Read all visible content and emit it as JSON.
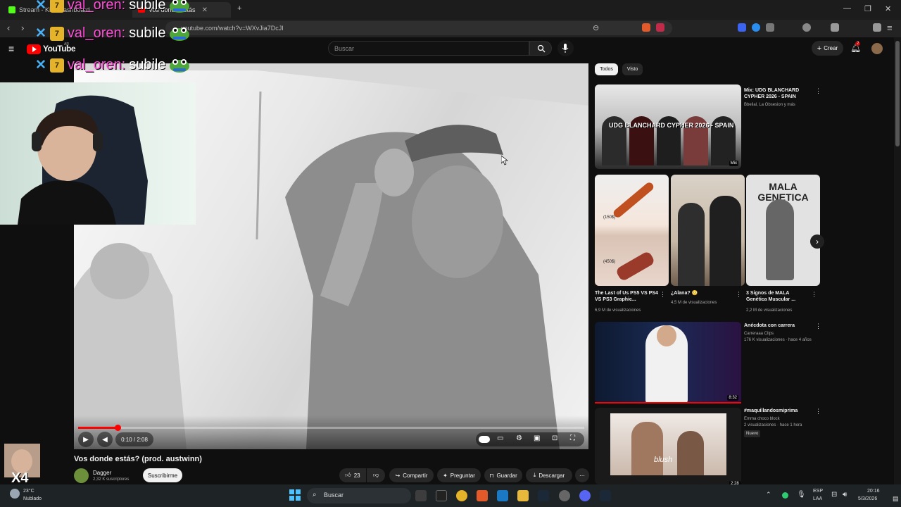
{
  "browser": {
    "tabs": [
      {
        "label": "Stream - Kick Dashboard"
      },
      {
        "label": "Vos donde estás"
      }
    ],
    "url": "youtube.com/watch?v=WXvJia7DcJI"
  },
  "youtube": {
    "logo_text": "YouTube",
    "logo_region": "AR",
    "search_placeholder": "Buscar",
    "create_label": "Crear",
    "notif_count": "2"
  },
  "player": {
    "time": "0:10 / 2:08",
    "progress_fraction": 0.078
  },
  "video": {
    "title": "Vos donde estás? (prod. austwinn)",
    "channel": "Dagger",
    "subscribers": "2,32 K suscriptores",
    "subscribe_label": "Suscribirme",
    "likes": "23",
    "share": "Compartir",
    "ask": "Preguntar",
    "save": "Guardar",
    "download": "Descargar"
  },
  "chips": [
    "Todos",
    "Visto"
  ],
  "recs": {
    "mix": {
      "title": "Mix: UDG BLANCHARD CYPHER 2026 - SPAIN",
      "meta": "Bbelial, La Obsesion y más",
      "thumb_text": "UDG BLANCHARD CYPHER 2026 - SPAIN",
      "badge": "Mix"
    },
    "shorts": [
      {
        "title": "The Last of Us PS5 VS PS4 VS PS3 Graphic...",
        "views": "6,9 M de visualizaciones",
        "t1": "(150$)",
        "t2": "(450$)"
      },
      {
        "title": "¿Alana? 😳",
        "views": "4,5 M de visualizaciones"
      },
      {
        "title": "3 Signos de MALA Genética Muscular ...",
        "views": "2,2 M de visualizaciones",
        "thumb_text": "MALA GENETICA"
      }
    ],
    "video1": {
      "title": "Anécdota con carrera",
      "channel": "Carreraaa Clips",
      "meta": "176 K visualizaciones · hace 4 años",
      "duration": "8:32"
    },
    "video2": {
      "title": "#maquillandosmiprima",
      "channel": "Emma choco block",
      "meta": "2 visualizaciones · hace 1 hora",
      "badge": "Nuevo",
      "overlay": "blush",
      "duration": "2:28"
    }
  },
  "overlay": {
    "chat_user": "val_oren:",
    "chat_msg": "subile",
    "combo": "X4"
  },
  "taskbar": {
    "weather_temp": "23°C",
    "weather_desc": "Nublado",
    "search": "Buscar",
    "lang1": "ESP",
    "lang2": "LAA",
    "time": "20:16",
    "date": "5/3/2026"
  }
}
